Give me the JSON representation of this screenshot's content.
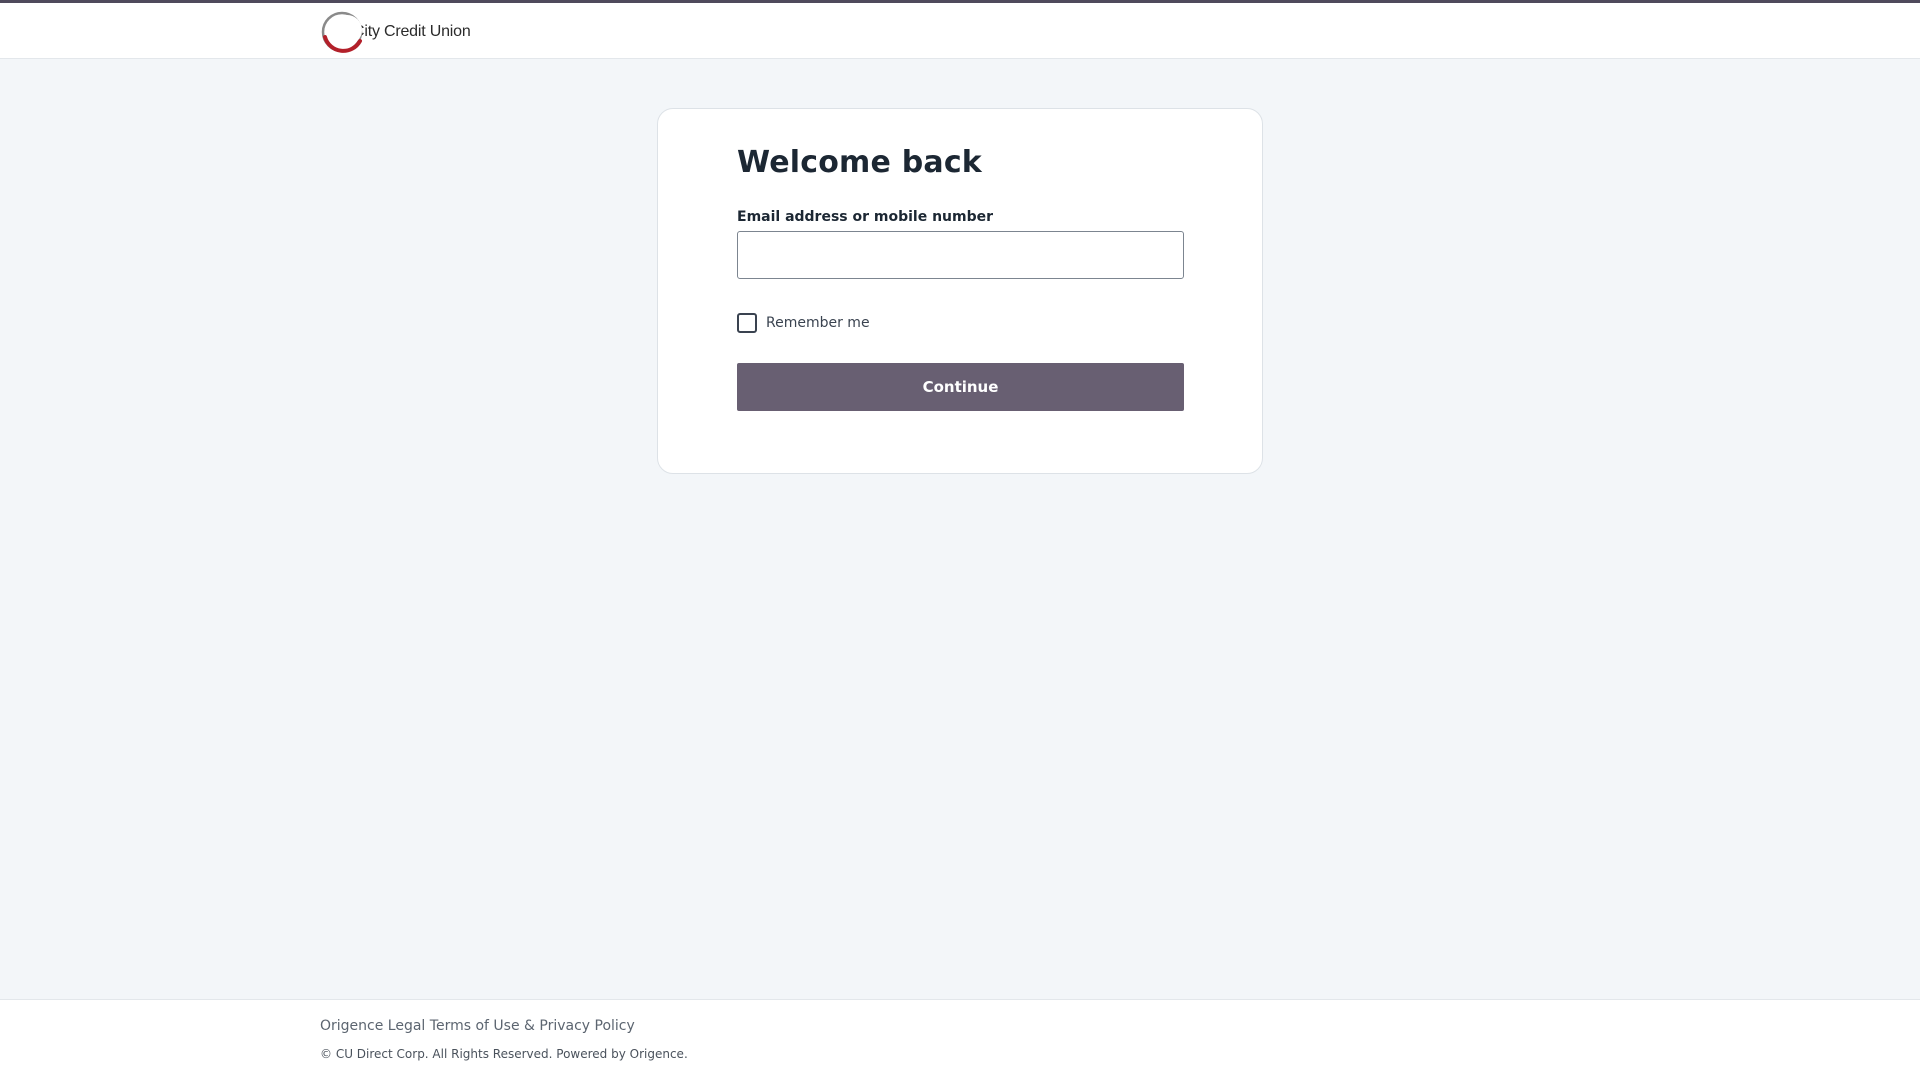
{
  "header": {
    "logo_text": "City Credit Union"
  },
  "login": {
    "title": "Welcome back",
    "email_label": "Email address or mobile number",
    "email_value": "",
    "remember_label": "Remember me",
    "remember_checked": false,
    "continue_label": "Continue"
  },
  "footer": {
    "links": [
      {
        "label": "Origence Legal"
      },
      {
        "label": "Terms of Use & Privacy Policy"
      }
    ],
    "copyright": "© CU Direct Corp. All Rights Reserved. Powered by Origence."
  },
  "colors": {
    "brand_primary": "#685f72",
    "top_bar": "#4f4a5c",
    "logo_red": "#b3202a",
    "background": "#f3f6f9"
  }
}
